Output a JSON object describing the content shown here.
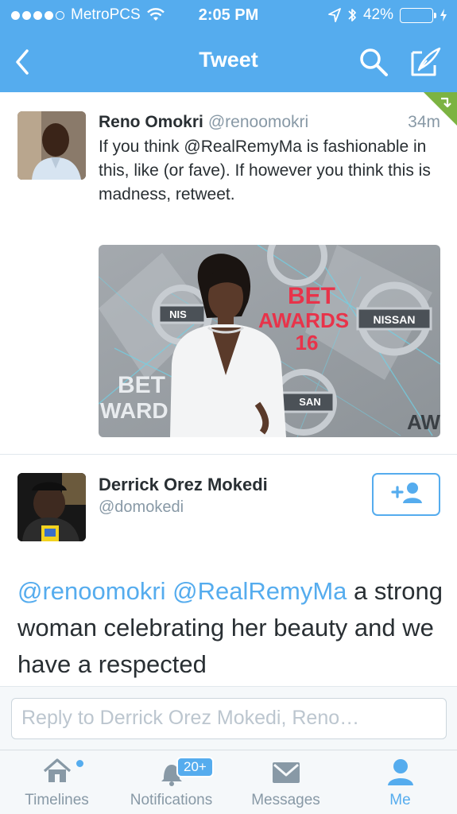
{
  "status_bar": {
    "carrier": "MetroPCS",
    "time": "2:05 PM",
    "battery_percent": "42%",
    "battery_level": 0.42
  },
  "nav": {
    "title": "Tweet",
    "back_icon": "chevron-left-icon",
    "search_icon": "search-icon",
    "compose_icon": "compose-icon"
  },
  "tweet1": {
    "name": "Reno Omokri",
    "handle": "@renoomokri",
    "time": "34m",
    "text": "If you think @RealRemyMa is fashionable in this, like (or fave). If however you think this is madness, retweet.",
    "media_texts": [
      "BET",
      "AWARDS",
      "16",
      "NISSAN",
      "NIS",
      "SAN",
      "AW",
      "WARD"
    ]
  },
  "tweet2": {
    "name": "Derrick Orez Mokedi",
    "handle": "@domokedi",
    "mention1": "@renoomokri",
    "mention2": "@RealRemyMa",
    "text_rest": " a strong woman celebrating her beauty and we have a respected"
  },
  "reply": {
    "placeholder": "Reply to Derrick Orez Mokedi, Reno…"
  },
  "tabs": [
    {
      "label": "Timelines",
      "icon": "home-icon",
      "active": false
    },
    {
      "label": "Notifications",
      "icon": "bell-icon",
      "badge": "20+",
      "active": false
    },
    {
      "label": "Messages",
      "icon": "envelope-icon",
      "active": false
    },
    {
      "label": "Me",
      "icon": "person-icon",
      "active": true
    }
  ],
  "colors": {
    "brand_blue": "#55acee",
    "text": "#292f33",
    "secondary": "#8899a6"
  }
}
